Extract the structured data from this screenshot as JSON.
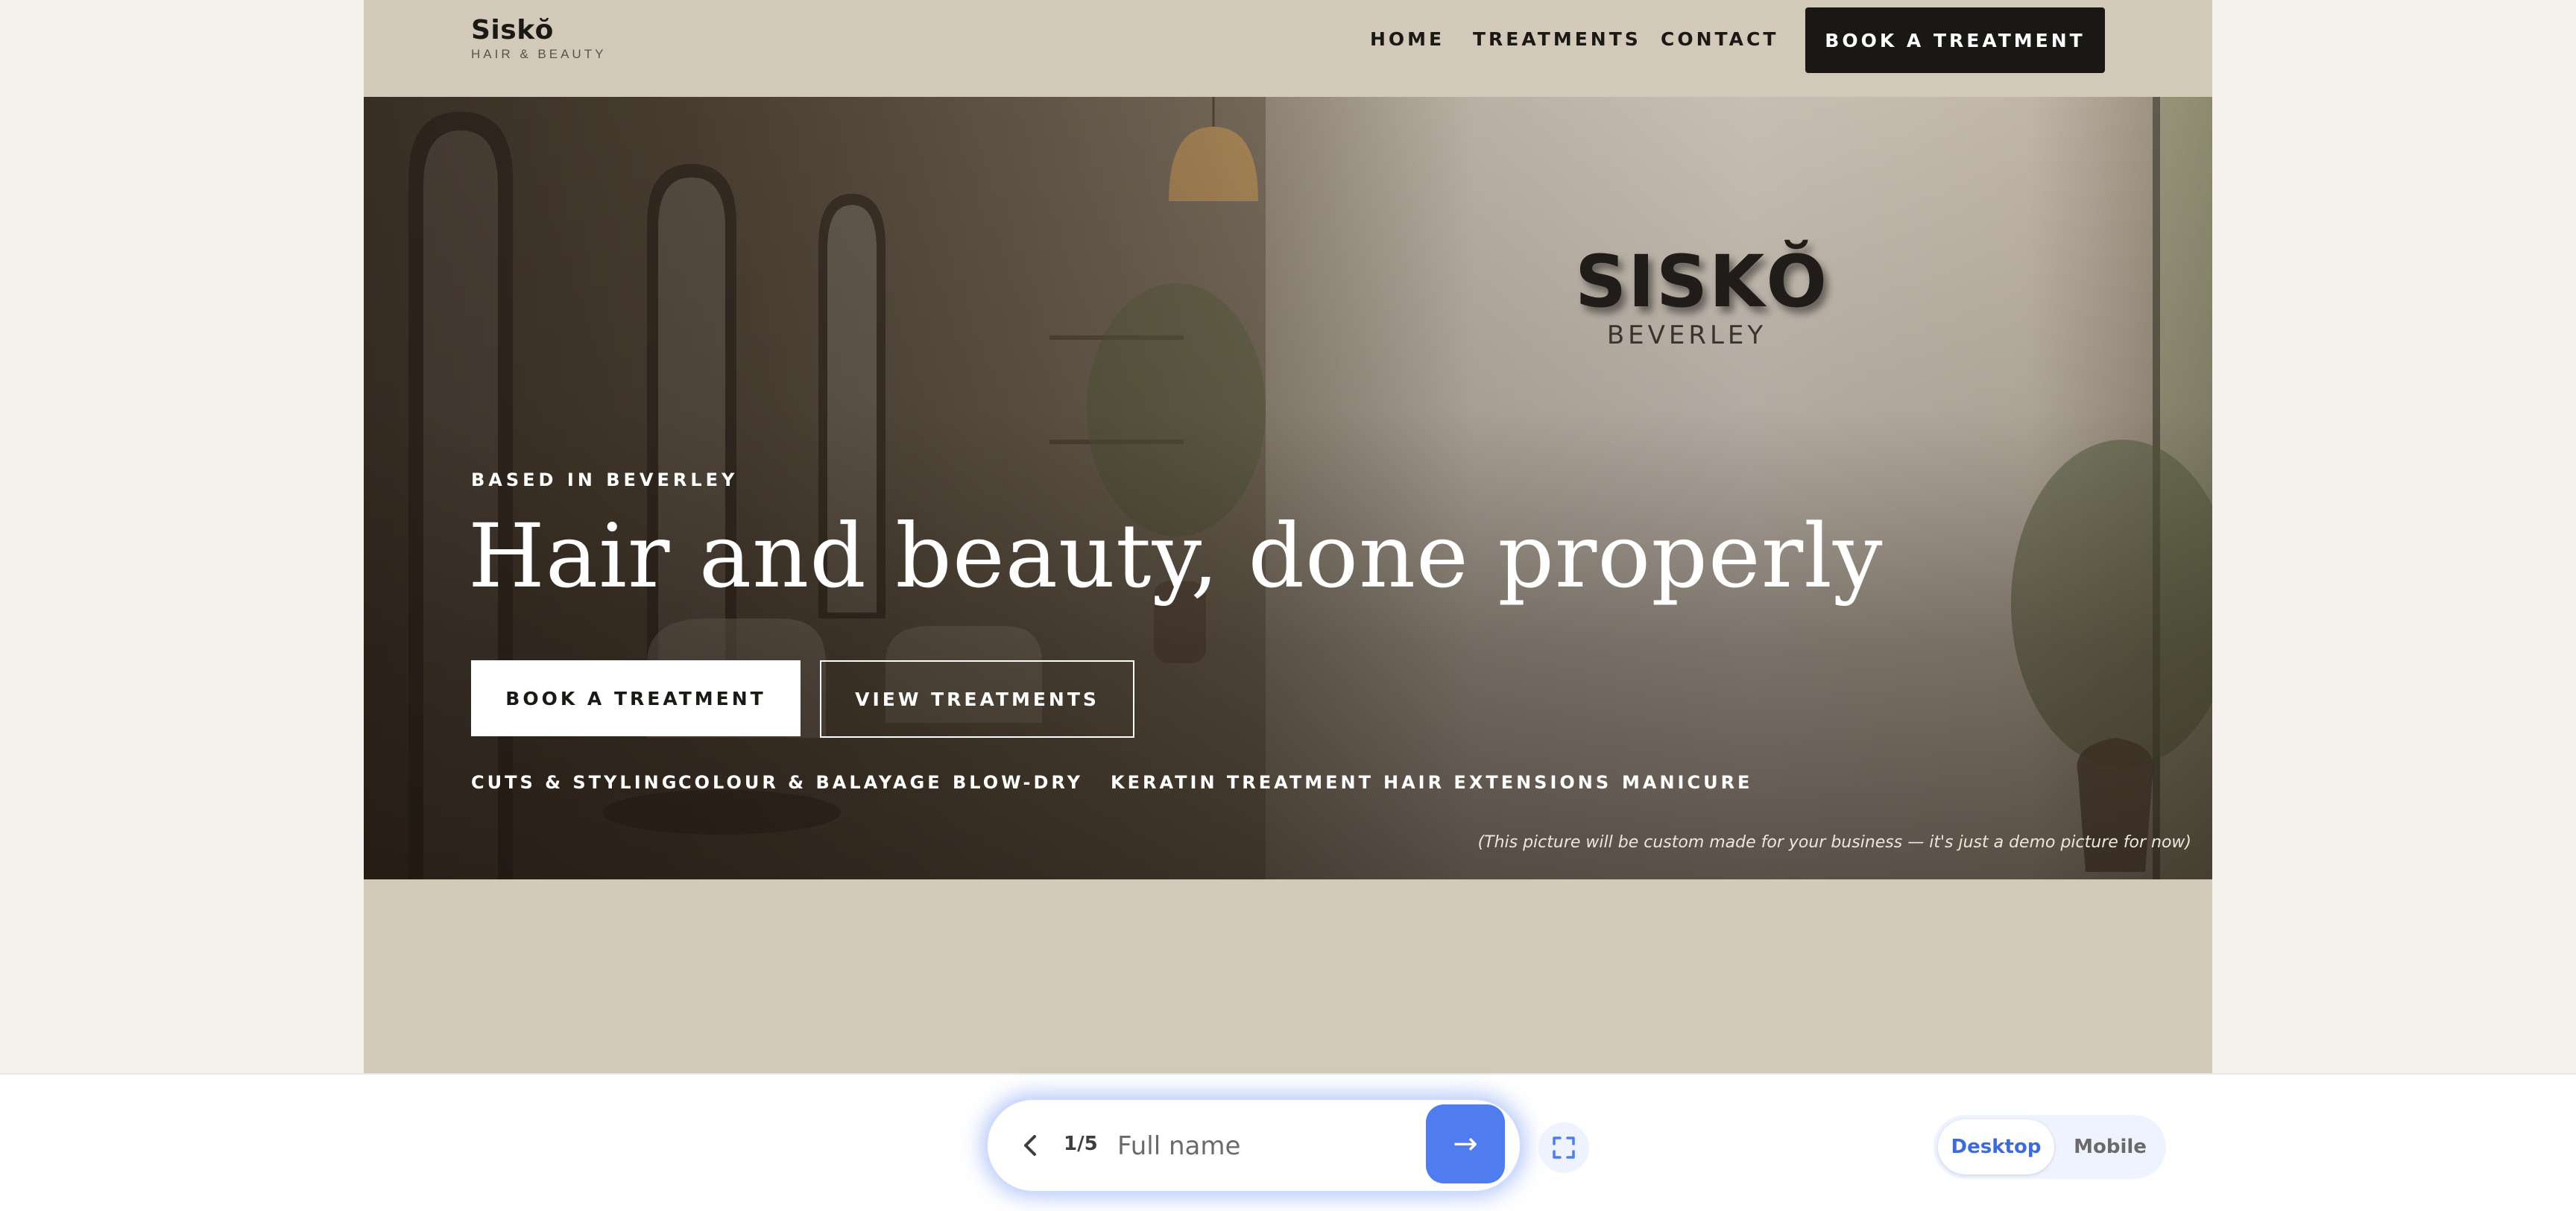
{
  "brand": {
    "name": "Siskŏ",
    "tagline": "HAIR & BEAUTY"
  },
  "nav": {
    "links": [
      "HOME",
      "TREATMENTS",
      "CONTACT"
    ],
    "cta": "BOOK A TREATMENT"
  },
  "hero": {
    "wall_logo": "SISKŎ",
    "wall_logo_sub": "BEVERLEY",
    "eyebrow": "BASED IN BEVERLEY",
    "headline": "Hair and beauty, done properly",
    "primary_button": "BOOK A TREATMENT",
    "secondary_button": "VIEW TREATMENTS",
    "services": [
      "CUTS & STYLING",
      "COLOUR & BALAYAGE",
      "BLOW-DRY",
      "KERATIN TREATMENT",
      "HAIR EXTENSIONS",
      "MANICURE"
    ],
    "note": "(This picture will be custom made for your business — it's just a demo picture for now)"
  },
  "form": {
    "step": "1/5",
    "placeholder": "Full name",
    "next_label": "→"
  },
  "view_toggle": {
    "desktop": "Desktop",
    "mobile": "Mobile",
    "selected": "Desktop"
  },
  "colors": {
    "header_bg": "#d3c9b9",
    "dark_button": "#1a1815",
    "accent_blue": "#4f7df0",
    "page_bg": "#f4f1ec"
  }
}
